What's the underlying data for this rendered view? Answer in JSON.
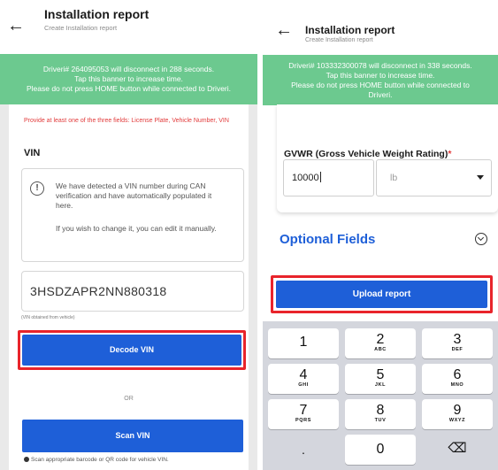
{
  "left": {
    "header": {
      "title": "Installation report",
      "subtitle": "Create Installation report"
    },
    "banner": {
      "lines": [
        "Driveri# 264095053 will disconnect in 288 seconds.",
        "Tap this banner to increase time.",
        "Please do not press HOME button while connected to Driveri."
      ]
    },
    "required_notice": "Provide at least one of the three fields: License Plate, Vehicle Number, VIN",
    "vin_label": "VIN",
    "notice": {
      "paragraph1": "We have detected a VIN number during CAN verification and have automatically populated it here.",
      "paragraph2": "If you wish to change it, you can edit it manually."
    },
    "vin_value": "3HSDZAPR2NN880318",
    "vin_note": "(VIN obtained from vehicle)",
    "decode_button": "Decode VIN",
    "or_text": "OR",
    "scan_button": "Scan VIN",
    "scan_note": "Scan appropriate barcode or QR code for vehicle VIN."
  },
  "right": {
    "header": {
      "title": "Installation report",
      "subtitle": "Create Installation report"
    },
    "banner": {
      "lines": [
        "Driveri# 103332300078 will disconnect in 338 seconds.",
        "Tap this banner to increase time.",
        "Please do not press HOME button while connected to",
        "Driveri."
      ]
    },
    "gvwr": {
      "label": "GVWR (Gross Vehicle Weight Rating)",
      "required_mark": "*",
      "value": "10000",
      "unit": "lb"
    },
    "optional_fields": "Optional Fields",
    "upload_button": "Upload report",
    "keypad": [
      {
        "num": "1",
        "letters": ""
      },
      {
        "num": "2",
        "letters": "ABC"
      },
      {
        "num": "3",
        "letters": "DEF"
      },
      {
        "num": "4",
        "letters": "GHI"
      },
      {
        "num": "5",
        "letters": "JKL"
      },
      {
        "num": "6",
        "letters": "MNO"
      },
      {
        "num": "7",
        "letters": "PQRS"
      },
      {
        "num": "8",
        "letters": "TUV"
      },
      {
        "num": "9",
        "letters": "WXYZ"
      },
      {
        "num": "0",
        "letters": ""
      }
    ],
    "keypad_extra": {
      "dot": ".",
      "backspace": "⌫"
    }
  },
  "colors": {
    "banner": "#6cc98f",
    "accent": "#1e5fd8",
    "highlight": "#e8242b",
    "required": "#e23b3b"
  },
  "icons": [
    "back-arrow-icon",
    "info-icon",
    "chevron-down-icon",
    "chevron-down-circle-icon",
    "backspace-icon",
    "barcode-icon"
  ]
}
